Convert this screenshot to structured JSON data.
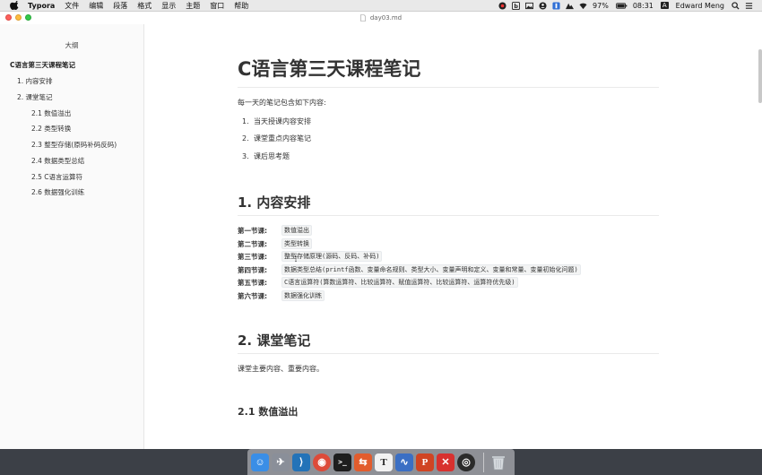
{
  "menubar": {
    "app_name": "Typora",
    "menus": [
      "文件",
      "编辑",
      "段落",
      "格式",
      "显示",
      "主题",
      "窗口",
      "帮助"
    ],
    "battery": "97%",
    "time": "08:31",
    "input_source": "A",
    "user": "Edward Meng",
    "status_icons": [
      "record-icon",
      "b-icon",
      "picture-icon",
      "person-icon",
      "antivirus-icon",
      "mountain-icon",
      "wifi-icon",
      "battery-icon",
      "search-icon",
      "menu-list-icon"
    ]
  },
  "window": {
    "title": "day03.md"
  },
  "sidebar": {
    "header": "大纲",
    "items": [
      {
        "label": "C语言第三天课程笔记",
        "level": 1
      },
      {
        "label": "1. 内容安排",
        "level": 2
      },
      {
        "label": "2. 课堂笔记",
        "level": 2
      },
      {
        "label": "2.1 数值溢出",
        "level": 3
      },
      {
        "label": "2.2 类型转换",
        "level": 3
      },
      {
        "label": "2.3 整型存储(原码补码反码)",
        "level": 3
      },
      {
        "label": "2.4 数据类型总结",
        "level": 3
      },
      {
        "label": "2.5 C语言运算符",
        "level": 3
      },
      {
        "label": "2.6 数据强化训练",
        "level": 3
      }
    ]
  },
  "document": {
    "h1": "C语言第三天课程笔记",
    "intro": "每一天的笔记包含如下内容:",
    "intro_list": [
      {
        "num": "1.",
        "text": "当天授课内容安排"
      },
      {
        "num": "2.",
        "text": "课堂重点内容笔记"
      },
      {
        "num": "3.",
        "text": "课后思考题"
      }
    ],
    "section1_title": "1. 内容安排",
    "schedule": [
      {
        "label": "第一节课:",
        "code": "数值溢出"
      },
      {
        "label": "第二节课:",
        "code": "类型转换"
      },
      {
        "label": "第三节课:",
        "code": "整型存储原理(源码、反码、补码)"
      },
      {
        "label": "第四节课:",
        "code": "数据类型总结(printf函数、变量命名规则、类型大小、变量声明和定义、变量和常量、变量初始化问题)"
      },
      {
        "label": "第五节课:",
        "code": "C语言运算符(算数运算符、比较运算符、赋值运算符、比较运算符、运算符优先级)"
      },
      {
        "label": "第六节课:",
        "code": "数据强化训练"
      }
    ],
    "section2_title": "2. 课堂笔记",
    "section2_intro": "课堂主要内容、重要内容。",
    "section21_title": "2.1 数值溢出"
  },
  "dock": {
    "apps": [
      {
        "name": "finder-icon",
        "color": "#3a8ee6",
        "glyph": "☺"
      },
      {
        "name": "launchpad-icon",
        "color": "#8a8f99",
        "glyph": "✈"
      },
      {
        "name": "vscode-icon",
        "color": "#2373b8",
        "glyph": "⟩"
      },
      {
        "name": "chrome-icon",
        "color": "#dd4b39",
        "glyph": "◉"
      },
      {
        "name": "terminal-icon",
        "color": "#1e1e1e",
        "glyph": ">_"
      },
      {
        "name": "network-app-icon",
        "color": "#e25c2d",
        "glyph": "⇆"
      },
      {
        "name": "typora-icon",
        "color": "#f2f2f2",
        "glyph": "T"
      },
      {
        "name": "paw-app-icon",
        "color": "#3b6fc4",
        "glyph": "∿"
      },
      {
        "name": "powerpoint-icon",
        "color": "#d04423",
        "glyph": "P"
      },
      {
        "name": "xmind-icon",
        "color": "#d8312f",
        "glyph": "✕"
      },
      {
        "name": "obs-icon",
        "color": "#2b2b2b",
        "glyph": "◎"
      }
    ],
    "trash": {
      "name": "trash-icon",
      "color": "#c9cdd2",
      "glyph": "🗑"
    }
  }
}
